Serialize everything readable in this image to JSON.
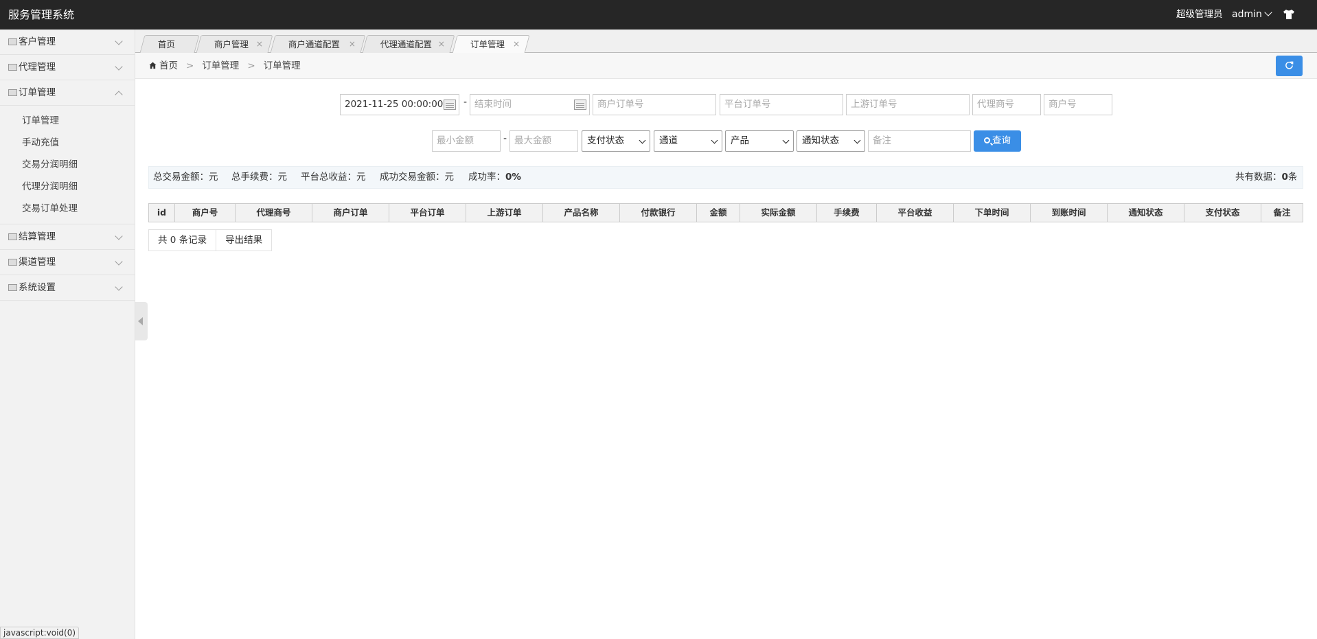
{
  "header": {
    "brand": "服务管理系统",
    "role": "超级管理员",
    "user": "admin",
    "icon": "shirt-icon"
  },
  "sidebar": {
    "groups": [
      {
        "label": "客户管理",
        "expanded": false
      },
      {
        "label": "代理管理",
        "expanded": false
      },
      {
        "label": "订单管理",
        "expanded": true,
        "items": [
          "订单管理",
          "手动充值",
          "交易分润明细",
          "代理分润明细",
          "交易订单处理"
        ]
      },
      {
        "label": "结算管理",
        "expanded": false
      },
      {
        "label": "渠道管理",
        "expanded": false
      },
      {
        "label": "系统设置",
        "expanded": false
      }
    ]
  },
  "tabs": [
    {
      "label": "首页",
      "closable": false
    },
    {
      "label": "商户管理",
      "closable": true
    },
    {
      "label": "商户通道配置",
      "closable": true
    },
    {
      "label": "代理通道配置",
      "closable": true
    },
    {
      "label": "订单管理",
      "closable": true,
      "active": true
    }
  ],
  "breadcrumb": [
    "首页",
    "订单管理",
    "订单管理"
  ],
  "filters": {
    "start_time": "2021-11-25 00:00:00",
    "end_time_placeholder": "结束时间",
    "merchant_order_placeholder": "商户订单号",
    "platform_order_placeholder": "平台订单号",
    "upstream_order_placeholder": "上游订单号",
    "agent_no_placeholder": "代理商号",
    "merchant_no_placeholder": "商户号",
    "min_amount_placeholder": "最小金额",
    "max_amount_placeholder": "最大金额",
    "pay_status": "支付状态",
    "channel": "通道",
    "product": "产品",
    "notify_status": "通知状态",
    "remark_placeholder": "备注",
    "query_label": "查询",
    "dash": "-"
  },
  "summary": {
    "total_amount_label": "总交易金额：",
    "total_amount_unit": "元",
    "total_fee_label": "总手续费：",
    "total_fee_unit": "元",
    "platform_income_label": "平台总收益：",
    "platform_income_unit": "元",
    "success_amount_label": "成功交易金额：",
    "success_amount_unit": "元",
    "success_rate_label": "成功率：",
    "success_rate_value": "0%",
    "total_count_label": "共有数据：",
    "total_count_value": "0",
    "total_count_unit": "条"
  },
  "table": {
    "columns": [
      "id",
      "商户号",
      "代理商号",
      "商户订单",
      "平台订单",
      "上游订单",
      "产品名称",
      "付款银行",
      "金额",
      "实际金额",
      "手续费",
      "平台收益",
      "下单时间",
      "到账时间",
      "通知状态",
      "支付状态",
      "备注"
    ]
  },
  "pager": {
    "count_text": "共 0 条记录",
    "export_label": "导出结果"
  },
  "status_bar": "javascript:void(0)"
}
